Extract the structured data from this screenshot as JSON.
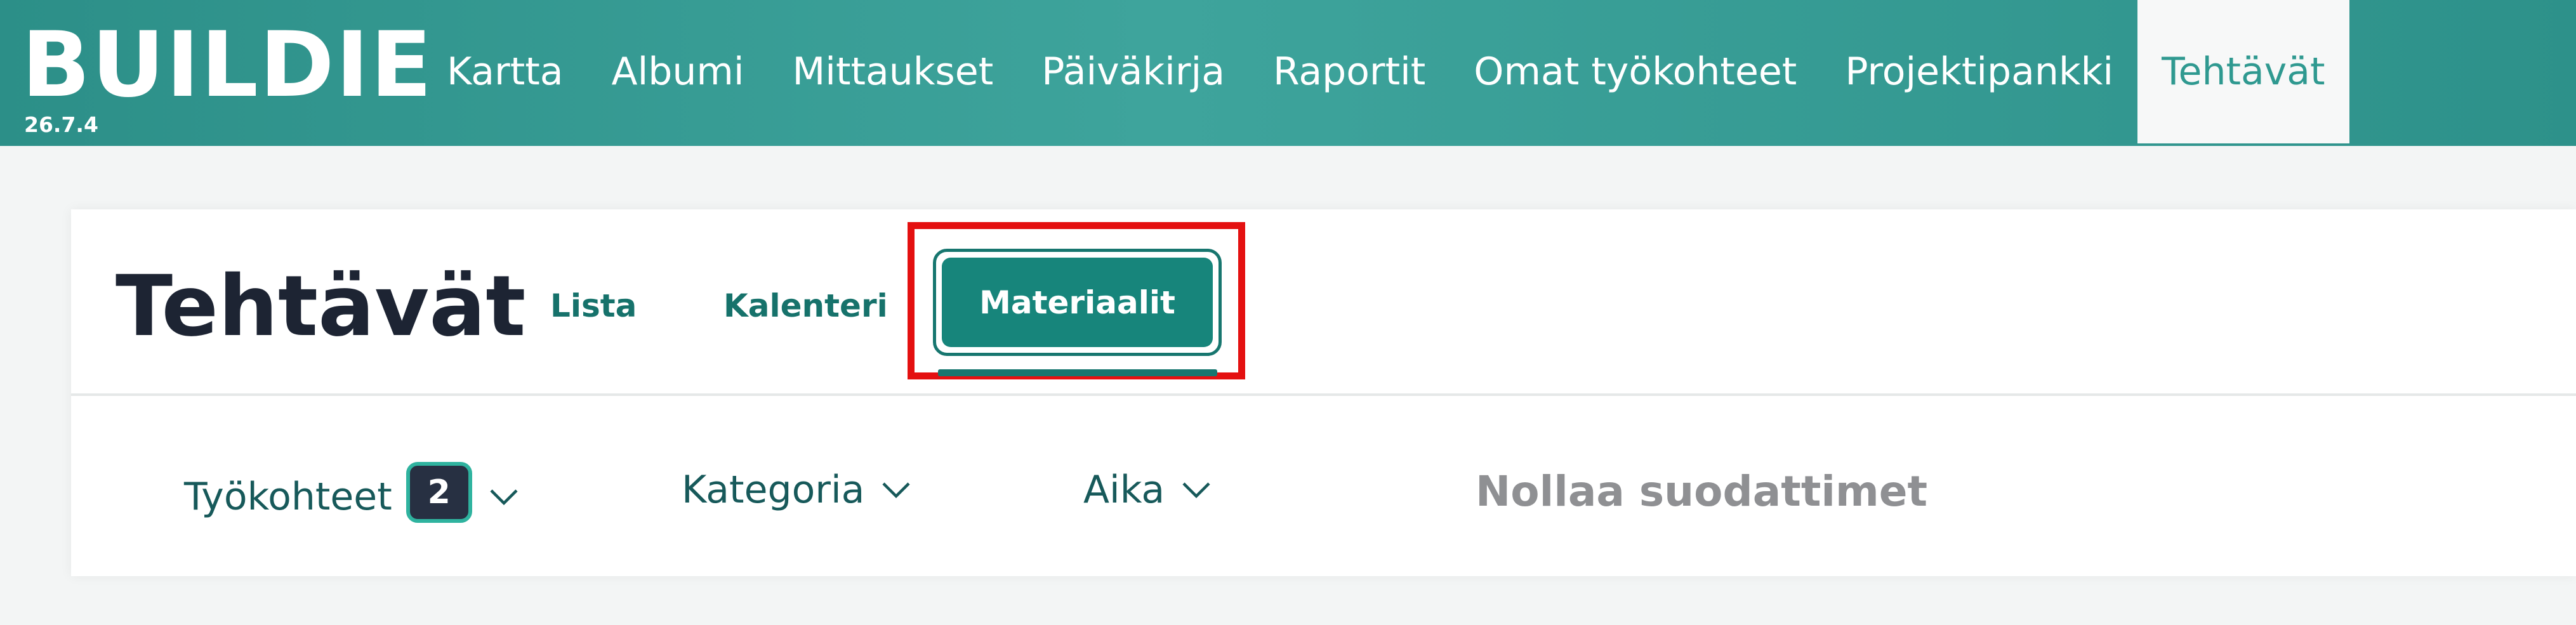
{
  "header": {
    "logo_text": "BUILDIE",
    "version": "26.7.4",
    "nav": [
      {
        "label": "Kartta",
        "active": false
      },
      {
        "label": "Albumi",
        "active": false
      },
      {
        "label": "Mittaukset",
        "active": false
      },
      {
        "label": "Päiväkirja",
        "active": false
      },
      {
        "label": "Raportit",
        "active": false
      },
      {
        "label": "Omat työkohteet",
        "active": false
      },
      {
        "label": "Projektipankki",
        "active": false
      },
      {
        "label": "Tehtävät",
        "active": true
      }
    ]
  },
  "page": {
    "title": "Tehtävät",
    "tabs": [
      {
        "label": "Lista",
        "active": false
      },
      {
        "label": "Kalenteri",
        "active": false
      },
      {
        "label": "Materiaalit",
        "active": true
      }
    ]
  },
  "filters": {
    "tyokohteet": {
      "label": "Työkohteet",
      "count": "2",
      "icon": "chevron-down-icon"
    },
    "kategoria": {
      "label": "Kategoria",
      "icon": "chevron-down-icon"
    },
    "aika": {
      "label": "Aika",
      "icon": "chevron-down-icon"
    },
    "reset_label": "Nollaa suodattimet"
  },
  "colors": {
    "brand": "#3ea49c",
    "accent": "#17857b",
    "highlight": "#e41010",
    "title": "#1d2433",
    "muted": "#8f9093"
  }
}
